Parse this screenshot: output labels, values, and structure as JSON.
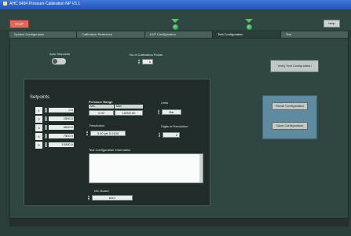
{
  "window": {
    "title": "AHC 9494 Pressure Calibration NP V3.1"
  },
  "toolbar": {
    "stop_label": "STOP",
    "help_label": "Help"
  },
  "tabs": [
    {
      "label": "System Configuration"
    },
    {
      "label": "Calibration Reference"
    },
    {
      "label": "UUT Configuration"
    },
    {
      "label": "Test Configuration"
    },
    {
      "label": "Test"
    }
  ],
  "test_config": {
    "auto_setpoints_label": "Auto Setpoints",
    "num_points_label": "No of Calibration Points",
    "num_points_value": "5",
    "verify_button": "Verify Test Configuration",
    "selected_table": "1000 Filter Table",
    "setpoints_label": "Setpoints",
    "setpoints": [
      {
        "index": "1",
        "value": "0.0"
      },
      {
        "index": "2",
        "value": "2500.0"
      },
      {
        "index": "3",
        "value": "5000.0"
      },
      {
        "index": "4",
        "value": "7500.0"
      },
      {
        "index": "5",
        "value": "10000.0"
      }
    ],
    "pressure_range_label": "Pressure Range",
    "range_min_hdr": "Min",
    "range_max_hdr": "Max",
    "range_min_value": "0.00",
    "range_max_value": "10000.00",
    "units_label": "Units",
    "units_value": "Bar",
    "resolution_label": "Resolution",
    "resolution_value": "0.00 psi 0.0100",
    "digits_label": "Digits of Resolution",
    "digits_value": "2",
    "info_label": "Test Configuration Information",
    "ahc_board_label": "IAC Board",
    "ahc_board_value": "AHC",
    "recall_button": "Recall Configuration",
    "save_button": "Save Configuration"
  }
}
